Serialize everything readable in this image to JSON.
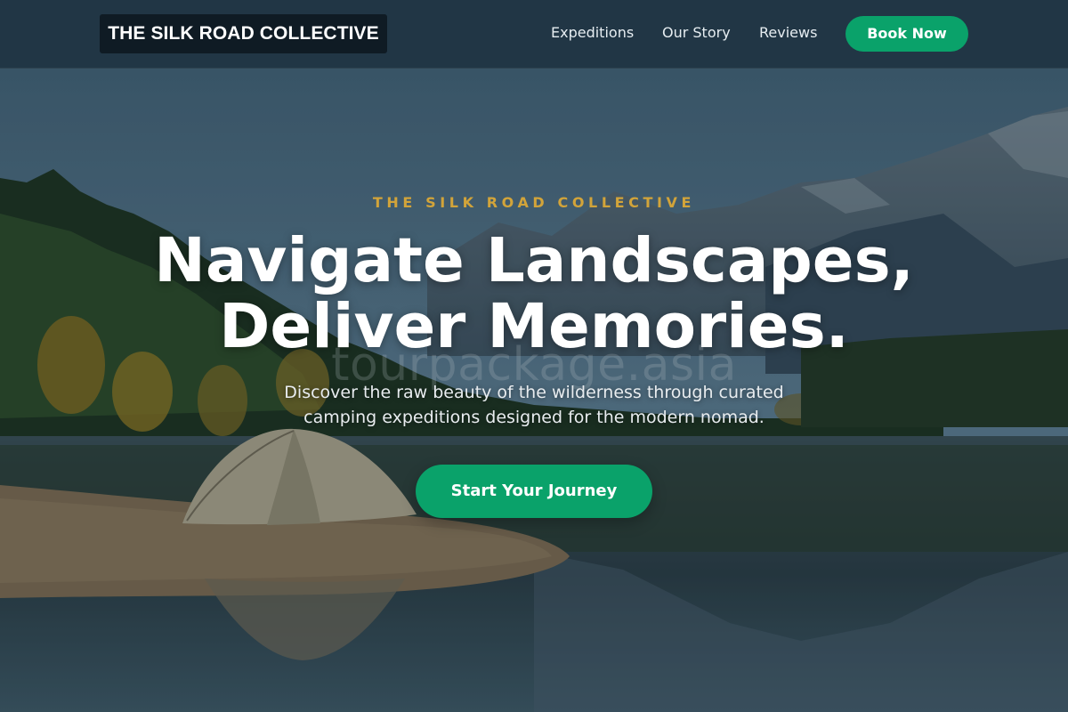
{
  "header": {
    "logo_text": "THE SILK ROAD COLLECTIVE",
    "nav": [
      {
        "label": "Expeditions"
      },
      {
        "label": "Our Story"
      },
      {
        "label": "Reviews"
      }
    ],
    "cta_label": "Book Now"
  },
  "hero": {
    "eyebrow": "THE SILK ROAD COLLECTIVE",
    "headline_line1": "Navigate Landscapes,",
    "headline_line2": "Deliver Memories.",
    "watermark": "tourpackage.asia",
    "subtitle": "Discover the raw beauty of the wilderness through curated camping expeditions designed for the modern nomad.",
    "cta_label": "Start Your Journey"
  },
  "colors": {
    "accent_green": "#0aa26a",
    "eyebrow_gold": "#d2a43a",
    "header_bg": "#203442",
    "logo_bg": "#0f1b24"
  }
}
